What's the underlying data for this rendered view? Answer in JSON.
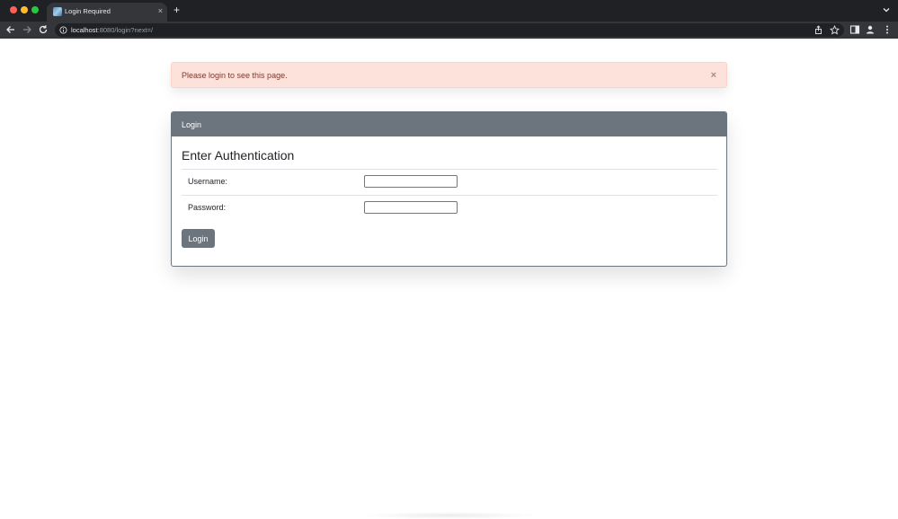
{
  "browser": {
    "tab": {
      "title": "Login Required",
      "favicon": "site-favicon-icon",
      "close_glyph": "×"
    },
    "new_tab_glyph": "+",
    "url": {
      "host": "localhost",
      "path": ":8080/login?next=/"
    }
  },
  "alert": {
    "message": "Please login to see this page.",
    "close_glyph": "×",
    "bg_color": "#fde1db",
    "text_color": "#7a3b2e"
  },
  "login_card": {
    "header": "Login",
    "title": "Enter Authentication",
    "username_label": "Username:",
    "username_value": "",
    "password_label": "Password:",
    "password_value": "",
    "submit_label": "Login",
    "accent_color": "#6c757d"
  }
}
